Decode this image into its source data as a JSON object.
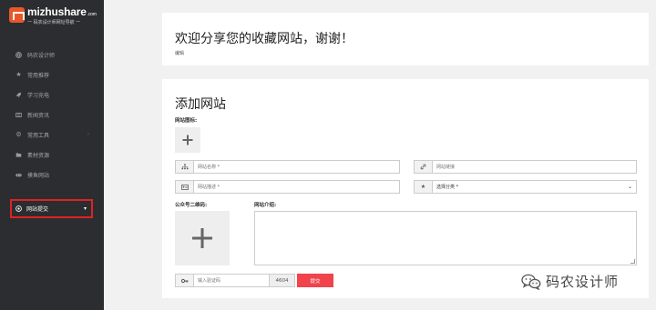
{
  "sidebar": {
    "logo_text": "mizhushare",
    "logo_domain": ".com",
    "logo_sub": "一 码农设计师网址导航 一",
    "items": [
      {
        "label": "码农设计师",
        "icon": "globe-icon"
      },
      {
        "label": "常用推荐",
        "icon": "star-icon"
      },
      {
        "label": "学习充电",
        "icon": "rocket-icon"
      },
      {
        "label": "新闻资讯",
        "icon": "newspaper-icon"
      },
      {
        "label": "常用工具",
        "icon": "gear-icon",
        "arrow": "›"
      },
      {
        "label": "素材资源",
        "icon": "folder-icon"
      },
      {
        "label": "摸鱼网站",
        "icon": "gamepad-icon"
      }
    ],
    "active_item": {
      "label": "网站提交",
      "icon": "chrome-icon",
      "caret": "▾"
    }
  },
  "welcome": {
    "title": "欢迎分享您的收藏网站，谢谢！",
    "subtitle": "编辑"
  },
  "form": {
    "title": "添加网站",
    "icon_label": "网站图标:",
    "name_placeholder": "网站名称 *",
    "url_placeholder": "网站链接",
    "desc_placeholder": "网站描述 *",
    "category_value": "选择分类 *",
    "qr_label": "公众号二维码:",
    "intro_label": "网站介绍:",
    "captcha_placeholder": "输入验证码",
    "captcha_code": "4604",
    "submit_label": "提交"
  },
  "watermark": {
    "text": "码农设计师"
  },
  "colors": {
    "sidebar_bg": "#2b2d30",
    "accent_red": "#f0434c",
    "highlight_border": "#e02222",
    "logo_orange": "#e8572a"
  }
}
